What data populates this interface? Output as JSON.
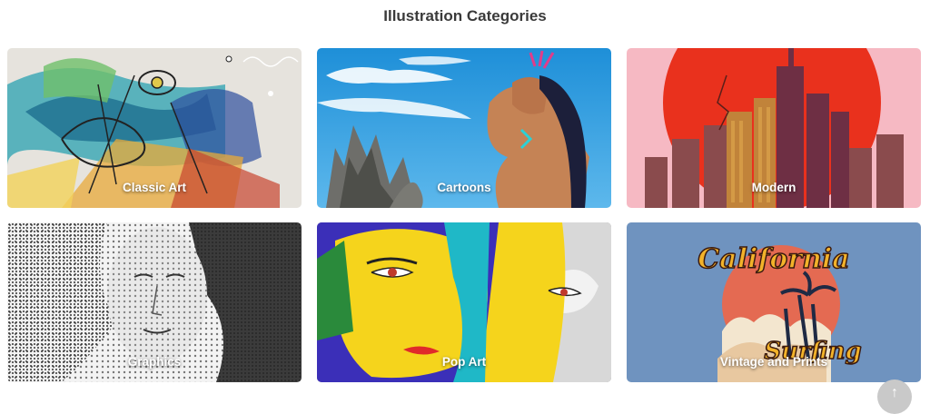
{
  "page": {
    "title": "Illustration Categories"
  },
  "categories": [
    {
      "label": "Classic Art"
    },
    {
      "label": "Cartoons"
    },
    {
      "label": "Modern"
    },
    {
      "label": "Graphics"
    },
    {
      "label": "Pop Art"
    },
    {
      "label": "Vintage and Prints"
    }
  ],
  "vintage_art_text": {
    "line1": "California",
    "line2": "Surfing"
  },
  "scroll_top": {
    "icon": "arrow-up-icon",
    "glyph": "↑"
  }
}
